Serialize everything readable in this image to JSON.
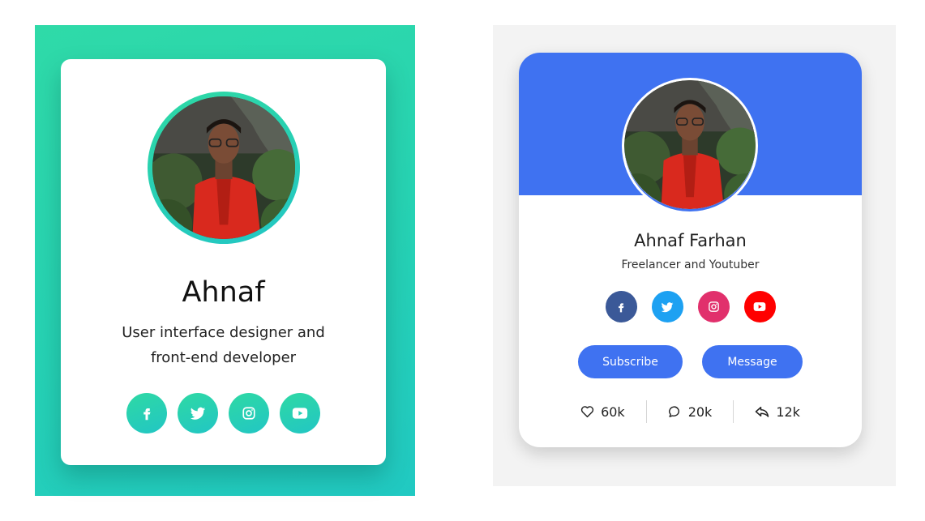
{
  "left_card": {
    "name": "Ahnaf",
    "description_line1": "User interface designer and",
    "description_line2": "front-end developer",
    "accent_color": "#2ed9a4",
    "social": [
      {
        "icon": "facebook-icon"
      },
      {
        "icon": "twitter-icon"
      },
      {
        "icon": "instagram-icon"
      },
      {
        "icon": "youtube-icon"
      }
    ]
  },
  "right_card": {
    "name": "Ahnaf Farhan",
    "role": "Freelancer and Youtuber",
    "header_color": "#3f72f1",
    "social": [
      {
        "icon": "facebook-icon",
        "color": "#3b5998"
      },
      {
        "icon": "twitter-icon",
        "color": "#1da1f2"
      },
      {
        "icon": "instagram-icon",
        "color": "#e1306c"
      },
      {
        "icon": "youtube-icon",
        "color": "#ff0000"
      }
    ],
    "buttons": {
      "subscribe": "Subscribe",
      "message": "Message"
    },
    "stats": {
      "likes": "60k",
      "comments": "20k",
      "shares": "12k"
    }
  }
}
